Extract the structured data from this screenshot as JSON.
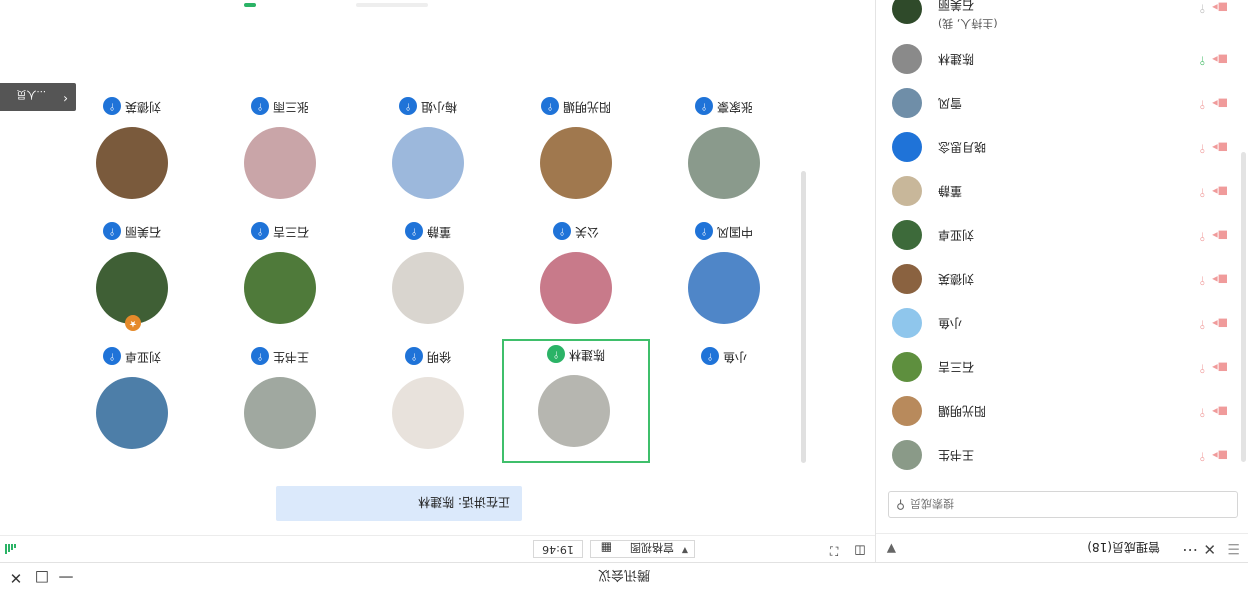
{
  "window": {
    "title": "腾讯会议",
    "buttons": [
      "minimize",
      "maximize",
      "close"
    ]
  },
  "panel": {
    "title": "管理成员(18)",
    "search_placeholder": "搜索成员",
    "participants": [
      {
        "name": "王书生",
        "avatar": "#8a9a88",
        "mic": "muted"
      },
      {
        "name": "阳光明媚",
        "avatar": "#b88a5c",
        "mic": "muted"
      },
      {
        "name": "石三吉",
        "avatar": "#5e8f3e",
        "mic": "muted"
      },
      {
        "name": "小鱼",
        "avatar": "#8fc6ec",
        "mic": "muted"
      },
      {
        "name": "刘德英",
        "avatar": "#8a6240",
        "mic": "muted"
      },
      {
        "name": "刘亚卓",
        "avatar": "#3d6a3a",
        "mic": "muted"
      },
      {
        "name": "董静",
        "avatar": "#c8b79a",
        "mic": "muted"
      },
      {
        "name": "晓月思念",
        "avatar": "#1f73d8",
        "mic": "muted"
      },
      {
        "name": "雪风",
        "avatar": "#6f8ea8",
        "mic": "muted"
      },
      {
        "name": "陈建林",
        "avatar": "#8a8a8a",
        "mic": "on"
      },
      {
        "name": "石美丽",
        "role": "(主持人, 我)",
        "avatar": "#2f4a2a",
        "mic": "idle"
      }
    ]
  },
  "toolbar": {
    "layout_label": "宫格视图",
    "timer": "19:46"
  },
  "speaking": {
    "text": "正在讲话: 陈建林"
  },
  "tiles": [
    {
      "name": "刘亚卓",
      "avatar": "#4d7ea8"
    },
    {
      "name": "王书生",
      "avatar": "#a0a8a0"
    },
    {
      "name": "徐明",
      "avatar": "#e8e2dc"
    },
    {
      "name": "陈建林",
      "avatar": "#b6b6b0",
      "active": true
    },
    {
      "name": "小鱼",
      "avatar": "#ffffff"
    },
    {
      "name": "石美丽",
      "avatar": "#3f5f35",
      "badge": "host"
    },
    {
      "name": "石三吉",
      "avatar": "#4f7a3a"
    },
    {
      "name": "董静",
      "avatar": "#d9d5cf"
    },
    {
      "name": "公关",
      "avatar": "#c87a8a"
    },
    {
      "name": "中国风",
      "avatar": "#4f86c8"
    },
    {
      "name": "刘德英",
      "avatar": "#7a5a3c"
    },
    {
      "name": "张三雨",
      "avatar": "#c9a5a8"
    },
    {
      "name": "梅小姐",
      "avatar": "#9cb8dc"
    },
    {
      "name": "阳光明媚",
      "avatar": "#a0784e"
    },
    {
      "name": "张家豪",
      "avatar": "#8a9a8c"
    }
  ],
  "side_toggle": "...人员"
}
